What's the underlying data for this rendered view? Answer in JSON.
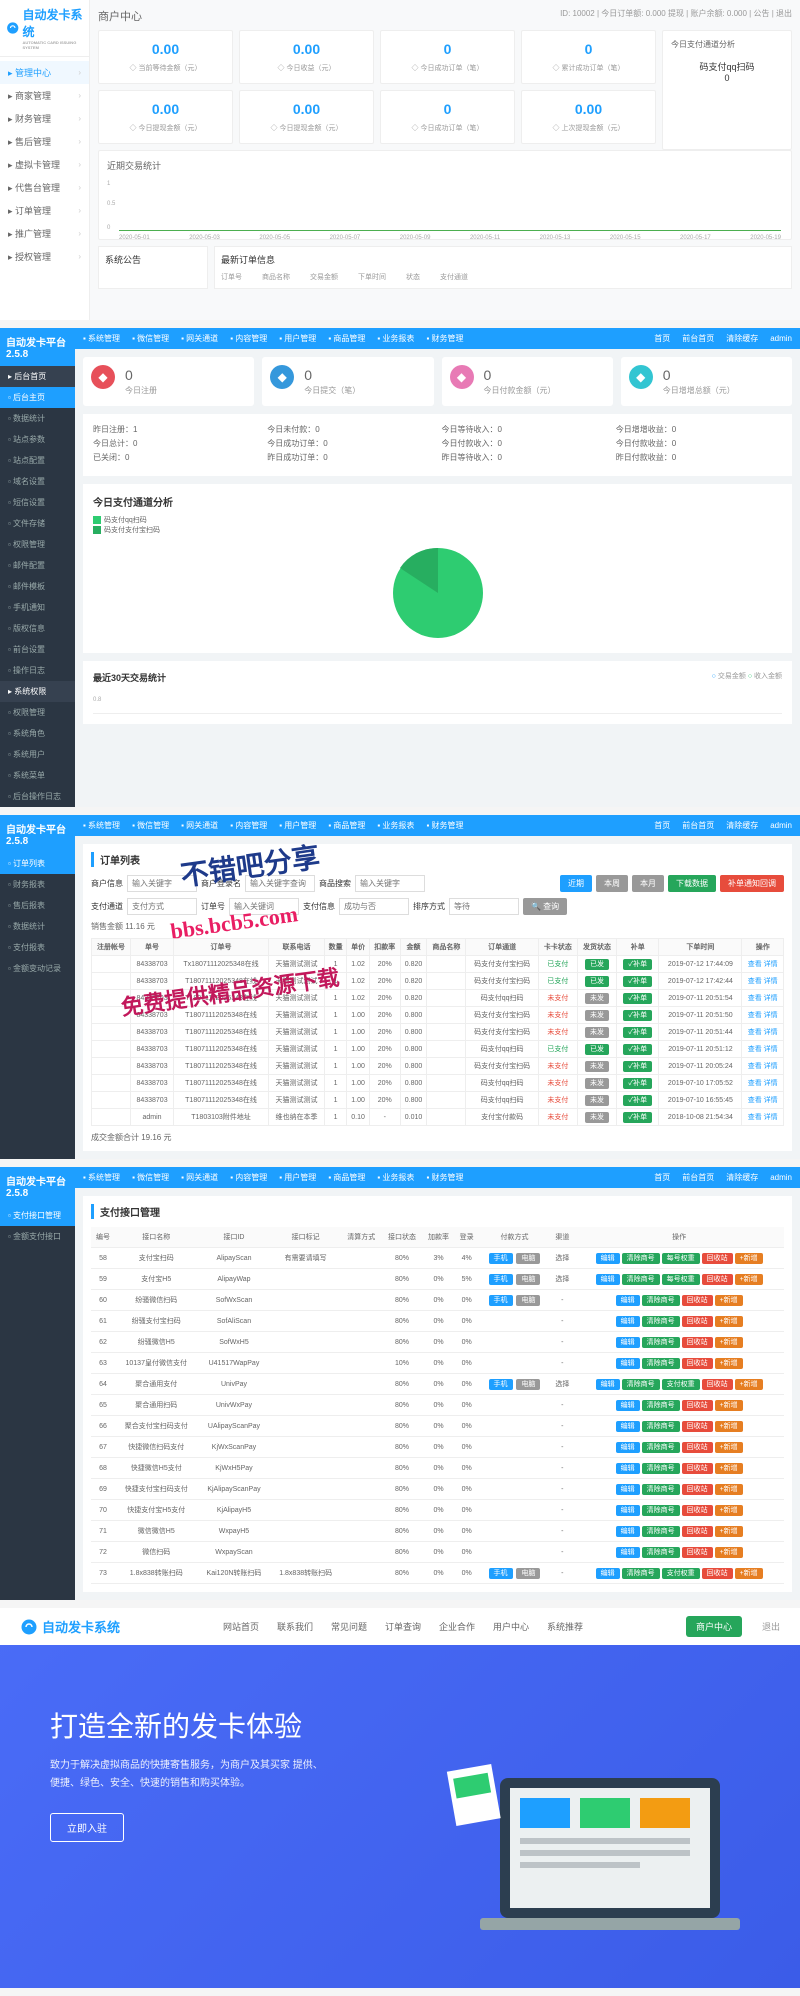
{
  "p1": {
    "logo": "自动发卡系统",
    "logoSub": "AUTOMATIC CARD ISSUING SYSTEM",
    "headerTitle": "商户中心",
    "headerRight": "ID: 10002 | 今日订单额: 0.000 提现 | 账户余额: 0.000 | 公告 | 退出",
    "menu": [
      "管理中心",
      "商家管理",
      "财务管理",
      "售后管理",
      "虚拟卡管理",
      "代售台管理",
      "订单管理",
      "推广管理",
      "授权管理"
    ],
    "stats1": [
      {
        "val": "0.00",
        "label": "当前等待金额（元）"
      },
      {
        "val": "0.00",
        "label": "今日收益（元）"
      },
      {
        "val": "0",
        "label": "今日成功订单（笔）"
      },
      {
        "val": "0",
        "label": "累计成功订单（笔）"
      }
    ],
    "stats2": [
      {
        "val": "0.00",
        "label": "今日提现金额（元）"
      },
      {
        "val": "0.00",
        "label": "今日提现金额（元）"
      },
      {
        "val": "0",
        "label": "今日成功订单（笔）"
      },
      {
        "val": "0.00",
        "label": "上次提现金额（元）"
      }
    ],
    "sideCard": {
      "title": "今日支付通道分析",
      "text": "码支付qq扫码",
      "val": "0"
    },
    "chartTitle": "近期交易统计",
    "dates": [
      "2020-05-01",
      "2020-05-03",
      "2020-05-05",
      "2020-05-07",
      "2020-05-09",
      "2020-05-11",
      "2020-05-13",
      "2020-05-15",
      "2020-05-17",
      "2020-05-19"
    ],
    "noticeTitle": "系统公告",
    "ordersTitle": "最新订单信息",
    "ordersCols": [
      "订单号",
      "商品名称",
      "交易金额",
      "下单时间",
      "状态",
      "支付通道"
    ]
  },
  "adminTop": [
    "系统管理",
    "微信管理",
    "网关通道",
    "内容管理",
    "用户管理",
    "商品管理",
    "业务报表",
    "财务管理"
  ],
  "adminTopRight": [
    "首页",
    "前台首页",
    "清除缓存",
    "admin"
  ],
  "adminLogo": "自动发卡平台 2.5.8",
  "p2": {
    "sideGroups": [
      {
        "title": "后台首页",
        "items": [
          "后台主页",
          "数据统计",
          "站点参数",
          "站点配置",
          "域名设置",
          "短信设置",
          "文件存储",
          "权限管理",
          "邮件配置",
          "邮件模板",
          "手机通知",
          "版权信息",
          "前台设置",
          "操作日志"
        ]
      },
      {
        "title": "系统权限",
        "items": [
          "权限管理",
          "系统角色",
          "系统用户",
          "系统菜单",
          "后台操作日志"
        ]
      }
    ],
    "cards": [
      {
        "icon": "red",
        "val": "0",
        "label": "今日注册"
      },
      {
        "icon": "blue",
        "val": "0",
        "label": "今日提交（笔）"
      },
      {
        "icon": "pink",
        "val": "0",
        "label": "今日付款金额（元）"
      },
      {
        "icon": "green",
        "val": "0",
        "label": "今日增增总额（元）"
      }
    ],
    "details": [
      [
        "昨日注册：1",
        "今日总计：0",
        "已关闭：0"
      ],
      [
        "今日未付款：0",
        "今日成功订单：0",
        "昨日成功订单：0"
      ],
      [
        "今日等待收入：0",
        "今日付款收入：0",
        "昨日等待收入：0"
      ],
      [
        "今日增增收益：0",
        "今日付款收益：0",
        "昨日付款收益：0"
      ]
    ],
    "pieTitle": "今日支付通道分析",
    "legends": [
      {
        "color": "#2ecc71",
        "text": "码支付qq扫码"
      },
      {
        "color": "#27ae60",
        "text": "码支付支付宝扫码"
      }
    ],
    "day30Title": "最近30天交易统计",
    "day30Legend": [
      "交易金额",
      "收入金额"
    ]
  },
  "p3": {
    "side": [
      "订单列表",
      "财务报表",
      "售后报表",
      "数据统计",
      "支付报表",
      "金额变动记录"
    ],
    "title": "订单列表",
    "filterLabels": [
      "商户信息",
      "输入关键字",
      "商户登录名",
      "输入关键字查询",
      "商品搜索",
      "输入关键字",
      "支付通道",
      "支付方式",
      "订单号",
      "输入关键词",
      "支付信息",
      "成功与否",
      "排序方式",
      "等待"
    ],
    "btns": [
      "近期",
      "本周",
      "本月",
      "下载数据",
      "补单通知回调"
    ],
    "amount": "销售金额 11.16 元",
    "cols": [
      "注册帐号",
      "单号",
      "订单号",
      "联系电话",
      "数量",
      "单价",
      "扣款率",
      "金额",
      "商品名称",
      "订单通道",
      "卡卡状态",
      "发货状态",
      "补单",
      "下单时间",
      "操作"
    ],
    "rows": [
      [
        "",
        "84338703",
        "Tx18071112025348在线",
        "天猫测试测试",
        "1",
        "1.02",
        "20%",
        "0.820",
        "",
        "码支付支付宝扫码",
        "已支付",
        "已发",
        "补单",
        "2019-07-12 17:44:09",
        "查看 详情"
      ],
      [
        "",
        "84338703",
        "T18071112025348在线",
        "天猫测试测试",
        "1",
        "1.02",
        "20%",
        "0.820",
        "",
        "码支付支付宝扫码",
        "已支付",
        "已发",
        "补单",
        "2019-07-12 17:42:44",
        "查看 详情"
      ],
      [
        "",
        "84338703",
        "T18071112025348在线",
        "天猫测试测试",
        "1",
        "1.02",
        "20%",
        "0.820",
        "",
        "码支付qq扫码",
        "未支付",
        "未发",
        "补单",
        "2019-07-11 20:51:54",
        "查看 详情"
      ],
      [
        "",
        "84338703",
        "T18071112025348在线",
        "天猫测试测试",
        "1",
        "1.00",
        "20%",
        "0.800",
        "",
        "码支付支付宝扫码",
        "未支付",
        "未发",
        "补单",
        "2019-07-11 20:51:50",
        "查看 详情"
      ],
      [
        "",
        "84338703",
        "T18071112025348在线",
        "天猫测试测试",
        "1",
        "1.00",
        "20%",
        "0.800",
        "",
        "码支付支付宝扫码",
        "未支付",
        "未发",
        "补单",
        "2019-07-11 20:51:44",
        "查看 详情"
      ],
      [
        "",
        "84338703",
        "T18071112025348在线",
        "天猫测试测试",
        "1",
        "1.00",
        "20%",
        "0.800",
        "",
        "码支付qq扫码",
        "已支付",
        "已发",
        "补单",
        "2019-07-11 20:51:12",
        "查看 详情"
      ],
      [
        "",
        "84338703",
        "T18071112025348在线",
        "天猫测试测试",
        "1",
        "1.00",
        "20%",
        "0.800",
        "",
        "码支付支付宝扫码",
        "未支付",
        "未发",
        "补单",
        "2019-07-11 20:05:24",
        "查看 详情"
      ],
      [
        "",
        "84338703",
        "T18071112025348在线",
        "天猫测试测试",
        "1",
        "1.00",
        "20%",
        "0.800",
        "",
        "码支付qq扫码",
        "未支付",
        "未发",
        "补单",
        "2019-07-10 17:05:52",
        "查看 详情"
      ],
      [
        "",
        "84338703",
        "T18071112025348在线",
        "天猫测试测试",
        "1",
        "1.00",
        "20%",
        "0.800",
        "",
        "码支付qq扫码",
        "未支付",
        "未发",
        "补单",
        "2019-07-10 16:55:45",
        "查看 详情"
      ],
      [
        "",
        "admin",
        "T1803103附件地址",
        "维也纳在本季",
        "1",
        "0.10",
        "-",
        "0.010",
        "",
        "支付宝付款码",
        "未支付",
        "未发",
        "补单",
        "2018-10-08 21:54:34",
        "查看 详情"
      ]
    ],
    "footer": "成交金额合计 19.16 元",
    "watermark1": "不错吧分享",
    "watermark2": "bbs.bcb5.com",
    "watermark3": "免费提供精品资源下载"
  },
  "p4": {
    "side": [
      "支付接口管理",
      "金额支付接口"
    ],
    "title": "支付接口管理",
    "cols": [
      "编号",
      "接口名称",
      "接口ID",
      "接口标记",
      "清算方式",
      "接口状态",
      "加款率",
      "登录",
      "付款方式",
      "渠道",
      "操作"
    ],
    "rows": [
      [
        "58",
        "支付宝扫码",
        "AlipayScan",
        "有需要请填写",
        "",
        "80%",
        "3%",
        "4%",
        "手机 电脑",
        "选择",
        [
          "编辑",
          "清除商号",
          "每号权重",
          "回收站",
          "+新增"
        ]
      ],
      [
        "59",
        "支付宝H5",
        "AlipayWap",
        "",
        "",
        "80%",
        "0%",
        "5%",
        "手机 电脑",
        "选择",
        [
          "编辑",
          "清除商号",
          "每号权重",
          "回收站",
          "+新增"
        ]
      ],
      [
        "60",
        "纷骚微信扫码",
        "SofWxScan",
        "",
        "",
        "80%",
        "0%",
        "0%",
        "手机 电脑",
        "-",
        [
          "编辑",
          "清除商号",
          "",
          "回收站",
          "+新增"
        ]
      ],
      [
        "61",
        "纷骚支付宝扫码",
        "SofAliScan",
        "",
        "",
        "80%",
        "0%",
        "0%",
        "",
        "-",
        [
          "编辑",
          "清除商号",
          "",
          "回收站",
          "+新增"
        ]
      ],
      [
        "62",
        "纷骚微信H5",
        "SofWxH5",
        "",
        "",
        "80%",
        "0%",
        "0%",
        "",
        "-",
        [
          "编辑",
          "清除商号",
          "",
          "回收站",
          "+新增"
        ]
      ],
      [
        "63",
        "10137皇付微信支付",
        "U41517WapPay",
        "",
        "",
        "10%",
        "0%",
        "0%",
        "",
        "-",
        [
          "编辑",
          "清除商号",
          "",
          "回收站",
          "+新增"
        ]
      ],
      [
        "64",
        "聚合通用支付",
        "UnivPay",
        "",
        "",
        "80%",
        "0%",
        "0%",
        "手机 电脑",
        "选择",
        [
          "编辑",
          "清除商号",
          "支付权重",
          "回收站",
          "+新增"
        ]
      ],
      [
        "65",
        "聚合通用扫码",
        "UnivWxPay",
        "",
        "",
        "80%",
        "0%",
        "0%",
        "",
        "-",
        [
          "编辑",
          "清除商号",
          "",
          "回收站",
          "+新增"
        ]
      ],
      [
        "66",
        "聚合支付宝扫码支付",
        "UAlipayScanPay",
        "",
        "",
        "80%",
        "0%",
        "0%",
        "",
        "-",
        [
          "编辑",
          "清除商号",
          "",
          "回收站",
          "+新增"
        ]
      ],
      [
        "67",
        "快捷微信扫码支付",
        "KjWxScanPay",
        "",
        "",
        "80%",
        "0%",
        "0%",
        "",
        "-",
        [
          "编辑",
          "清除商号",
          "",
          "回收站",
          "+新增"
        ]
      ],
      [
        "68",
        "快捷微信H5支付",
        "KjWxH5Pay",
        "",
        "",
        "80%",
        "0%",
        "0%",
        "",
        "-",
        [
          "编辑",
          "清除商号",
          "",
          "回收站",
          "+新增"
        ]
      ],
      [
        "69",
        "快捷支付宝扫码支付",
        "KjAlipayScanPay",
        "",
        "",
        "80%",
        "0%",
        "0%",
        "",
        "-",
        [
          "编辑",
          "清除商号",
          "",
          "回收站",
          "+新增"
        ]
      ],
      [
        "70",
        "快捷支付宝H5支付",
        "KjAlipayH5",
        "",
        "",
        "80%",
        "0%",
        "0%",
        "",
        "-",
        [
          "编辑",
          "清除商号",
          "",
          "回收站",
          "+新增"
        ]
      ],
      [
        "71",
        "微信微信H5",
        "WxpayH5",
        "",
        "",
        "80%",
        "0%",
        "0%",
        "",
        "-",
        [
          "编辑",
          "清除商号",
          "",
          "回收站",
          "+新增"
        ]
      ],
      [
        "72",
        "微信扫码",
        "WxpayScan",
        "",
        "",
        "80%",
        "0%",
        "0%",
        "",
        "-",
        [
          "编辑",
          "清除商号",
          "",
          "回收站",
          "+新增"
        ]
      ],
      [
        "73",
        "1.8x838转账扫码",
        "Kai120N转账扫码",
        "1.8x838转账扫码",
        "",
        "80%",
        "0%",
        "0%",
        "手机 电脑",
        "-",
        [
          "编辑",
          "清除商号",
          "支付权重",
          "回收站",
          "+新增"
        ]
      ]
    ]
  },
  "p5": {
    "logo": "自动发卡系统",
    "nav": [
      "网站首页",
      "联系我们",
      "常见问题",
      "订单查询",
      "企业合作",
      "用户中心",
      "系统推荐"
    ],
    "btnUser": "商户中心",
    "btnExit": "退出",
    "heroTitle": "打造全新的发卡体验",
    "heroText": "致力于解决虚拟商品的快捷寄售服务，为商户及其买家 提供、便捷、绿色、安全、快速的销售和购买体验。",
    "cta": "立即入驻"
  },
  "chart_data": {
    "type": "line",
    "title": "近期交易统计",
    "categories": [
      "2020-05-01",
      "2020-05-03",
      "2020-05-05",
      "2020-05-07",
      "2020-05-09",
      "2020-05-11",
      "2020-05-13",
      "2020-05-15",
      "2020-05-17",
      "2020-05-19"
    ],
    "values": [
      0,
      0,
      0,
      0,
      0,
      0,
      0,
      0,
      0,
      0
    ],
    "ylim": [
      0,
      1
    ],
    "xlabel": "",
    "ylabel": ""
  }
}
